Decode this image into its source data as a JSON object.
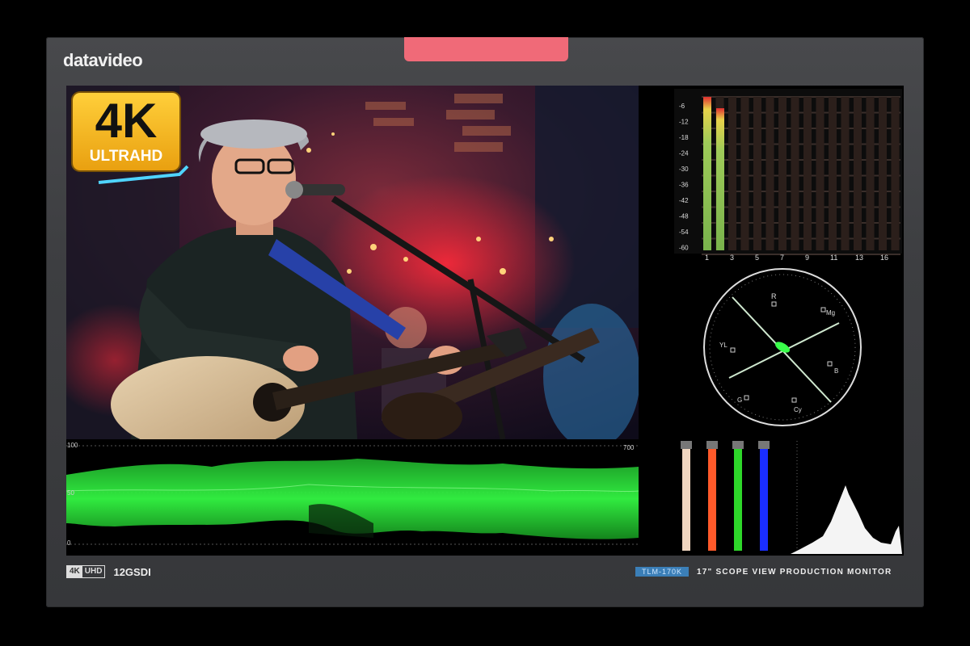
{
  "brand": "datavideo",
  "badge": {
    "main": "4K",
    "sub": "ULTRAHD"
  },
  "audio_meter": {
    "db_ticks": [
      "-6",
      "-12",
      "-18",
      "-24",
      "-30",
      "-36",
      "-42",
      "-48",
      "-54",
      "-60"
    ],
    "channels": [
      "1",
      "3",
      "5",
      "7",
      "9",
      "11",
      "13",
      "16"
    ]
  },
  "vectorscope": {
    "labels": [
      "R",
      "Mg",
      "YL",
      "B",
      "G",
      "Cy"
    ]
  },
  "waveform": {
    "top": "100",
    "mid": "50",
    "bottom": "0",
    "right_top": "700"
  },
  "footer": {
    "tag_a": "4K",
    "tag_b": "UHD",
    "sdi": "12GSDI",
    "model": "TLM-170K",
    "tagline": "17\" SCOPE VIEW PRODUCTION MONITOR"
  },
  "colors": {
    "tally": "#f06a78",
    "badge": "#f5b41c",
    "wave": "#2aff3a"
  }
}
